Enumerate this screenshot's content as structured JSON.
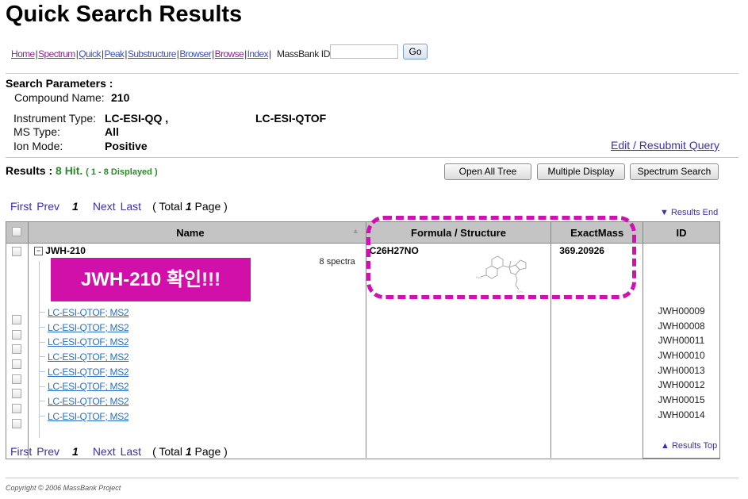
{
  "page": {
    "title": "Quick Search Results"
  },
  "nav": {
    "links": [
      {
        "label": "Home",
        "state": "visited"
      },
      {
        "label": "Spectrum",
        "state": "visited"
      },
      {
        "label": "Quick",
        "state": "link"
      },
      {
        "label": "Peak",
        "state": "link"
      },
      {
        "label": "Substructure",
        "state": "link"
      },
      {
        "label": "Browser",
        "state": "link"
      },
      {
        "label": "Browse",
        "state": "visited"
      },
      {
        "label": "Index",
        "state": "link"
      }
    ],
    "massbank_id_label": "MassBank ID:",
    "massbank_id_value": "",
    "go_label": "Go"
  },
  "search_params": {
    "title": "Search Parameters :",
    "compound_label": "Compound Name:",
    "compound_value": "210",
    "instrument_label": "Instrument Type:",
    "instrument_values": [
      "LC-ESI-QQ ,",
      "LC-ESI-QTOF"
    ],
    "ms_type_label": "MS Type:",
    "ms_type_value": "All",
    "ion_mode_label": "Ion Mode:",
    "ion_mode_value": "Positive",
    "edit_link": "Edit / Resubmit Query"
  },
  "results": {
    "label": "Results :",
    "hits": "8 Hit.",
    "displayed": "( 1 - 8 Displayed )",
    "buttons": [
      "Open All Tree",
      "Multiple Display",
      "Spectrum Search"
    ],
    "results_end": "▼ Results End",
    "results_top": "▲ Results Top"
  },
  "pager": {
    "first": "First",
    "prev": "Prev",
    "current": "1",
    "next": "Next",
    "last": "Last",
    "total_prefix": "( Total ",
    "total_pages": "1",
    "total_suffix": " Page )"
  },
  "table": {
    "headers": {
      "name": "Name",
      "formula": "Formula / Structure",
      "mass": "ExactMass",
      "id": "ID"
    },
    "compound": {
      "name": "JWH-210",
      "spectra_count": "8 spectra",
      "formula": "C26H27NO",
      "exact_mass": "369.20926"
    },
    "spectra": [
      {
        "label": "LC-ESI-QTOF; MS2",
        "id": "JWH00009"
      },
      {
        "label": "LC-ESI-QTOF; MS2",
        "id": "JWH00008"
      },
      {
        "label": "LC-ESI-QTOF; MS2",
        "id": "JWH00011"
      },
      {
        "label": "LC-ESI-QTOF; MS2",
        "id": "JWH00010"
      },
      {
        "label": "LC-ESI-QTOF; MS2",
        "id": "JWH00013"
      },
      {
        "label": "LC-ESI-QTOF; MS2",
        "id": "JWH00012"
      },
      {
        "label": "LC-ESI-QTOF; MS2",
        "id": "JWH00015"
      },
      {
        "label": "LC-ESI-QTOF; MS2",
        "id": "JWH00014"
      }
    ]
  },
  "annotation": {
    "text": "JWH-210 확인!!!",
    "color": "#d010a8"
  },
  "footer": {
    "copyright": "Copyright © 2006 MassBank Project"
  }
}
